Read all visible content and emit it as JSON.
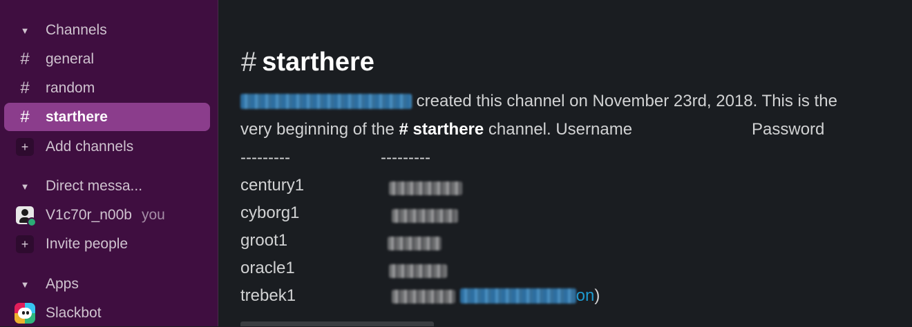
{
  "sidebar": {
    "channels_header": "Channels",
    "channels": [
      {
        "label": "general",
        "active": false
      },
      {
        "label": "random",
        "active": false
      },
      {
        "label": "starthere",
        "active": true
      }
    ],
    "add_channels": "Add channels",
    "dm_header": "Direct messa...",
    "dm_user": "V1c70r_n00b",
    "dm_you": "you",
    "invite_people": "Invite people",
    "apps_header": "Apps",
    "app": "Slackbot"
  },
  "channel": {
    "hash": "#",
    "name": "starthere",
    "intro_created": "created this channel on November 23rd, 2018. This is the",
    "intro_very": "very beginning of the",
    "intro_channel_hash": "#",
    "intro_channel_name": "starthere",
    "intro_tail": "channel. Username",
    "password_label": "Password",
    "dash_1": "---------",
    "dash_2": "---------",
    "usernames": [
      "century1",
      "cyborg1",
      "groot1",
      "oracle1",
      "trebek1"
    ],
    "link_tail": "on",
    "close_paren": ")"
  },
  "colors": {
    "sidebar_bg": "#3f0e40",
    "active_bg": "#8b3d8c",
    "main_bg": "#1a1d21",
    "link": "#1d9bd1",
    "presence": "#2bac76"
  }
}
